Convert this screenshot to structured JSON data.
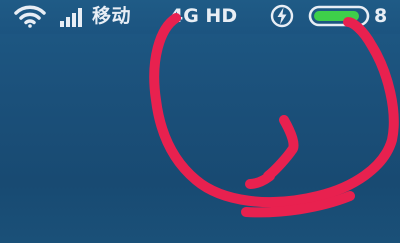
{
  "status_bar": {
    "carrier_label": "移动",
    "network_label": "4G HD",
    "battery_label": "8",
    "icons": [
      "wifi-icon",
      "signal-strength-icon",
      "charging-icon",
      "battery-icon"
    ],
    "battery_level": 0.9,
    "battery_color": "#3ecf4a",
    "text_color": "#e8eef5"
  },
  "annotation": {
    "color": "#e8214f"
  },
  "wallpaper": {
    "color": "#1b4f78"
  }
}
